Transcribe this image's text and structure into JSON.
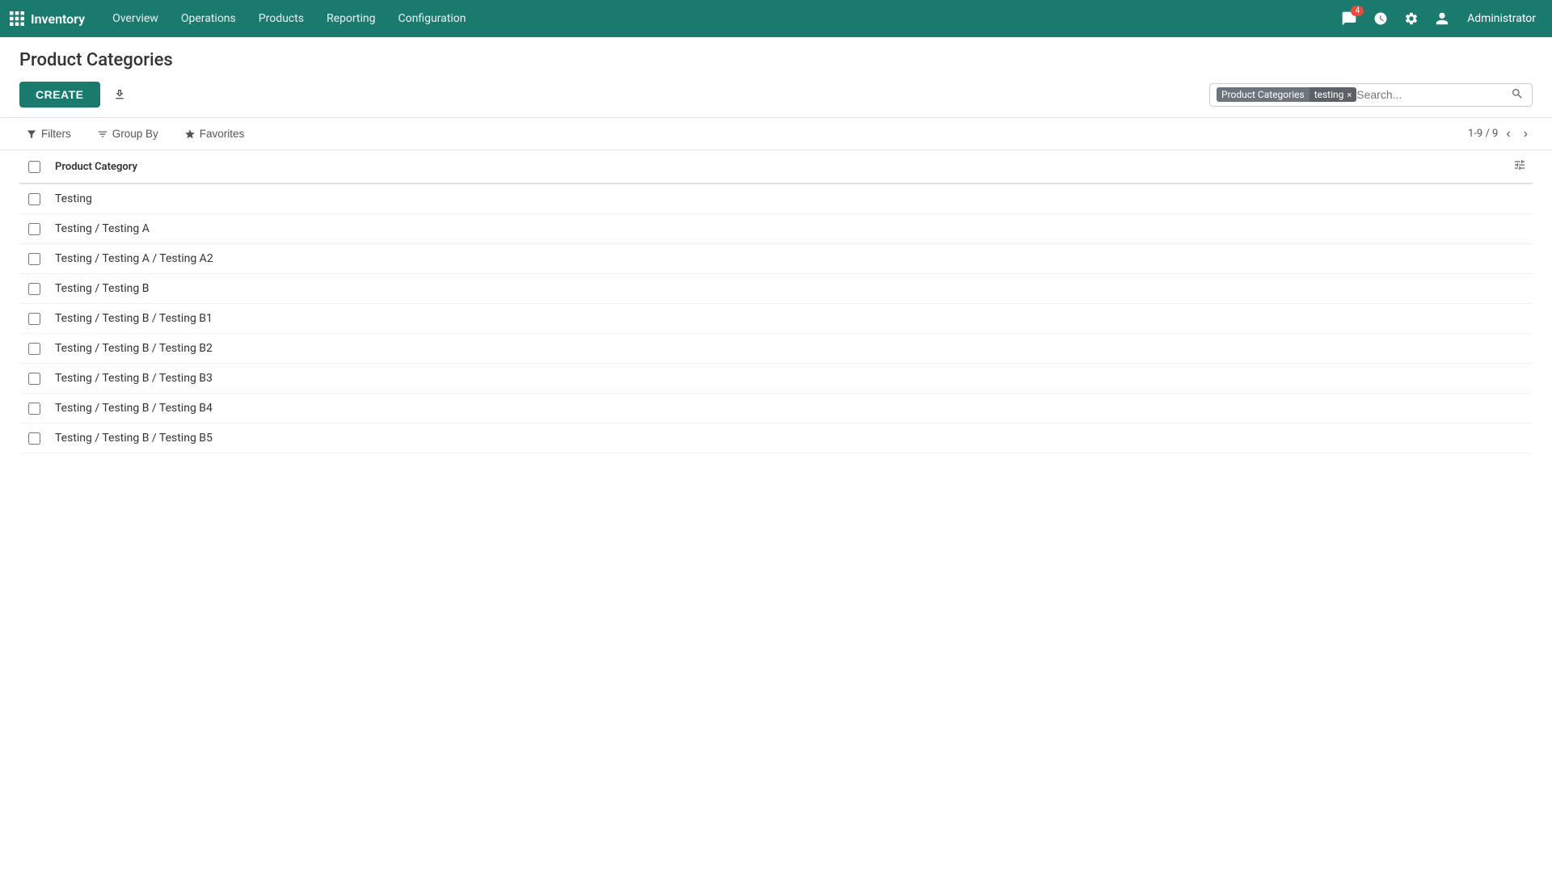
{
  "app": {
    "brand": "Inventory",
    "nav_items": [
      "Overview",
      "Operations",
      "Products",
      "Reporting",
      "Configuration"
    ]
  },
  "topnav_right": {
    "chat_count": "4",
    "user": "Administrator"
  },
  "page": {
    "title": "Product Categories"
  },
  "toolbar": {
    "create_label": "CREATE"
  },
  "search": {
    "tag_category": "Product Categories",
    "tag_value": "testing",
    "placeholder": "Search..."
  },
  "filters": {
    "filters_label": "Filters",
    "groupby_label": "Group By",
    "favorites_label": "Favorites"
  },
  "pagination": {
    "text": "1-9 / 9"
  },
  "table": {
    "col_header": "Product Category",
    "rows": [
      {
        "name": "Testing"
      },
      {
        "name": "Testing / Testing A"
      },
      {
        "name": "Testing / Testing A / Testing A2"
      },
      {
        "name": "Testing / Testing B"
      },
      {
        "name": "Testing / Testing B / Testing B1"
      },
      {
        "name": "Testing / Testing B / Testing B2"
      },
      {
        "name": "Testing / Testing B / Testing B3"
      },
      {
        "name": "Testing / Testing B / Testing B4"
      },
      {
        "name": "Testing / Testing B / Testing B5"
      }
    ]
  }
}
